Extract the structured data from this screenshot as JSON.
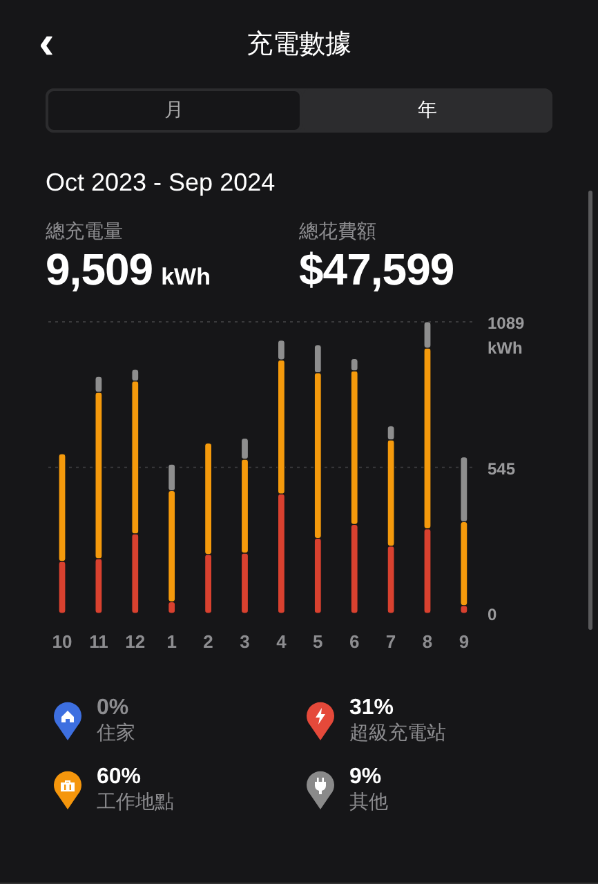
{
  "header": {
    "back": "‹",
    "title": "充電數據"
  },
  "tabs": [
    {
      "label": "月",
      "selected": false
    },
    {
      "label": "年",
      "selected": true
    }
  ],
  "period": "Oct 2023 - Sep 2024",
  "stats": [
    {
      "label": "總充電量",
      "value": "9,509",
      "unit": "kWh"
    },
    {
      "label": "總花費額",
      "value": "$47,599"
    }
  ],
  "chart_data": {
    "type": "bar",
    "stacked": true,
    "orientation": "vertical",
    "ylabel": "kWh",
    "categories": [
      "10",
      "11",
      "12",
      "1",
      "2",
      "3",
      "4",
      "5",
      "6",
      "7",
      "8",
      "9"
    ],
    "series": [
      {
        "color": "#d9412f",
        "values": [
          194,
          204,
          297,
          43,
          220,
          225,
          446,
          280,
          332,
          251,
          316,
          29
        ]
      },
      {
        "color": "#f59a0c",
        "values": [
          402,
          622,
          571,
          415,
          416,
          351,
          501,
          619,
          574,
          397,
          675,
          313
        ]
      },
      {
        "color": "#8e8e8e",
        "values": [
          0,
          59,
          43,
          99,
          0,
          78,
          73,
          104,
          45,
          52,
          98,
          242
        ]
      }
    ],
    "ylim": [
      0,
      1089
    ],
    "yticks": [
      {
        "value": 0,
        "label": "0"
      },
      {
        "value": 545,
        "label": "545"
      },
      {
        "value": 1089,
        "label": "1089"
      }
    ]
  },
  "legend": [
    {
      "kind": "home",
      "percent": "0%",
      "label": "住家",
      "color": "#3d6fe0",
      "dimmed": true
    },
    {
      "kind": "bolt",
      "percent": "31%",
      "label": "超級充電站",
      "color": "#e5493a",
      "dimmed": false
    },
    {
      "kind": "briefcase",
      "percent": "60%",
      "label": "工作地點",
      "color": "#f5960c",
      "dimmed": false
    },
    {
      "kind": "plug",
      "percent": "9%",
      "label": "其他",
      "color": "#8a8a8a",
      "dimmed": false
    }
  ]
}
